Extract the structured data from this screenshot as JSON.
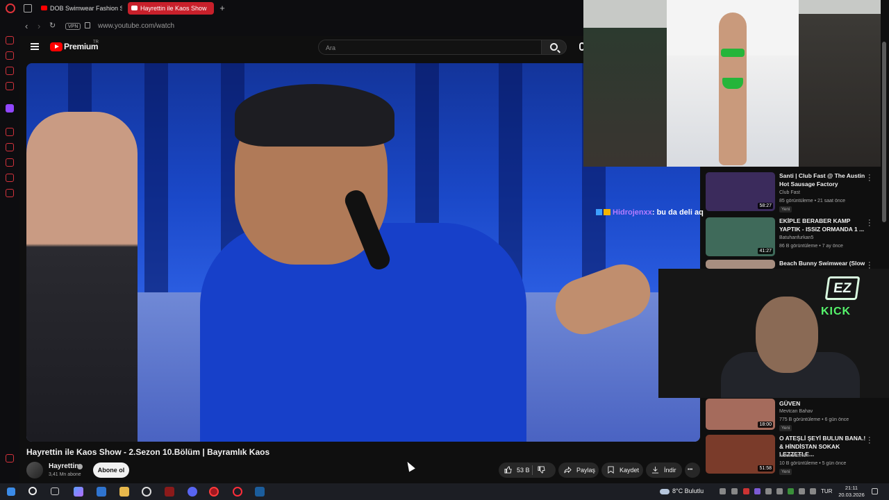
{
  "browser": {
    "tabs": [
      {
        "label": "DOB Swimwear Fashion Sh"
      },
      {
        "label": "Hayrettin ile Kaos Show"
      }
    ],
    "new_tab": "+",
    "vpn_label": "VPN",
    "url": "www.youtube.com/watch"
  },
  "youtube": {
    "logo_text": "Premium",
    "region": "TR",
    "search_placeholder": "Ara"
  },
  "overlay": {
    "chat": {
      "user": "Hidrojenxx",
      "message": ": bu da deli aq"
    },
    "streamer_badge_ez": "EZ",
    "streamer_badge_kick": "KICK"
  },
  "recommendations": [
    {
      "title": "Santi | Club Fast @ The Austin Hot Sausage Factory",
      "channel": "Club Fast",
      "views": "85 görüntüleme • 21 saat önce",
      "badge": "Yeni",
      "duration": "58:27",
      "thumb_color": "#3b2b5c"
    },
    {
      "title": "EKİPLE BERABER KAMP YAPTIK - ISSIZ ORMANDA 1 ...",
      "channel": "Batuhanfurkan5",
      "views": "86 B görüntüleme • 7 ay önce",
      "badge": "",
      "duration": "41:27",
      "thumb_color": "#3f6a5a"
    },
    {
      "title": "Beach Bunny Swimwear (Slow",
      "channel": "",
      "views": "",
      "badge": "",
      "duration": "",
      "thumb_color": "#a78e80"
    },
    {
      "title": "GÜVEN",
      "channel": "Mevtcan Bahav",
      "views": "775 B görüntüleme • 6 gün önce",
      "badge": "Yeni",
      "duration": "18:00",
      "thumb_color": "#a56b5c"
    },
    {
      "title": "O ATEŞLİ ŞEYİ BULUN BANA.! & HİNDİSTAN SOKAK LEZZETLE...",
      "channel": "kickmeister5",
      "views": "10 B görüntüleme • 5 gün önce",
      "badge": "Yeni",
      "duration": "51:58",
      "thumb_color": "#7a3b2a"
    }
  ],
  "video": {
    "title": "Hayrettin ile Kaos Show - 2.Sezon 10.Bölüm | Bayramlık Kaos",
    "channel": "Hayrettin",
    "subscribers": "3,41 Mn abone",
    "subscribe_label": "Abone ol",
    "likes": "53 B",
    "share_label": "Paylaş",
    "save_label": "Kaydet",
    "download_label": "İndir",
    "more_label": "•••"
  },
  "taskbar": {
    "weather": "8°C  Bulutlu",
    "language": "TUR",
    "time": "21:11",
    "date": "20.03.2026"
  },
  "colors": {
    "brand_red": "#ff0000",
    "opera_red": "#d4333c",
    "active_tab": "#c8202b",
    "twitch_purple": "#9146ff",
    "kick_green": "#56f56c"
  }
}
